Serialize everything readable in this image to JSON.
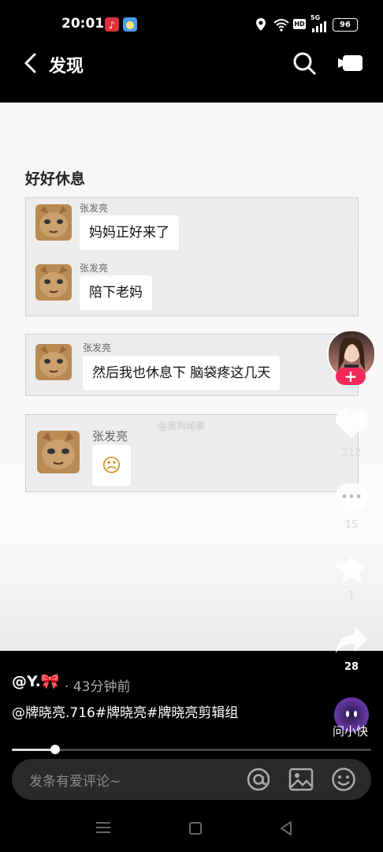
{
  "status_bar": {
    "time": "20:01",
    "battery": "96",
    "network": "5G",
    "hd_label": "HD"
  },
  "top_bar": {
    "title": "发现",
    "back_icon": "chevron-left-icon",
    "search_icon": "search-icon",
    "camera_icon": "video-camera-icon"
  },
  "post": {
    "title": "好好休息",
    "watermark": "@黑狗闻事",
    "chat_panels": [
      {
        "messages": [
          {
            "sender": "张发亮",
            "text": "妈妈正好来了"
          },
          {
            "sender": "张发亮",
            "text": "陪下老妈"
          }
        ]
      },
      {
        "messages": [
          {
            "sender": "张发亮",
            "text": "然后我也休息下 脑袋疼这几天"
          }
        ]
      },
      {
        "messages": [
          {
            "sender": "张发亮",
            "text": "☹"
          }
        ]
      }
    ]
  },
  "rail": {
    "likes": "212",
    "comments": "15",
    "favorites": "1",
    "shares": "28",
    "ask_label": "问小快"
  },
  "footer": {
    "username": "@Y.🎀",
    "time_ago": "· 43分钟前",
    "caption": "@牌晓亮.716#牌晓亮#牌晓亮剪辑组",
    "progress": 0.12,
    "comment_placeholder": "发条有爱评论~"
  }
}
